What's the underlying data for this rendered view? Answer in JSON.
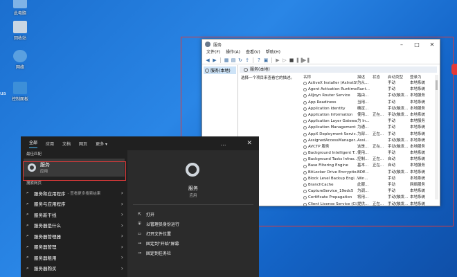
{
  "desktop": {
    "icons": [
      {
        "label": "此电脑",
        "name": "this-pc"
      },
      {
        "label": "回收站",
        "name": "recycle-bin"
      },
      {
        "label": "网络",
        "name": "network"
      },
      {
        "label": "控制面板",
        "name": "control-panel"
      }
    ],
    "left_fragment": "ua"
  },
  "services_window": {
    "title": "服务",
    "menu": [
      "文件(F)",
      "操作(A)",
      "查看(V)",
      "帮助(H)"
    ],
    "tree_item": "服务(本地)",
    "header": "服务(本地)",
    "description": "选择一个项目来查看它的描述。",
    "columns": [
      "名称",
      "描述",
      "状态",
      "启动类型",
      "登录为"
    ],
    "rows": [
      [
        "ActiveX Installer (AxInstSV)",
        "为从...",
        "",
        "手动",
        "本地系统"
      ],
      [
        "Agent Activation Runtime...",
        "Runt...",
        "",
        "手动",
        "本地系统"
      ],
      [
        "AllJoyn Router Service",
        "路由...",
        "",
        "手动(触发...",
        "本地服务"
      ],
      [
        "App Readiness",
        "当用...",
        "",
        "手动",
        "本地系统"
      ],
      [
        "Application Identity",
        "确定...",
        "",
        "手动(触发...",
        "本地服务"
      ],
      [
        "Application Information",
        "使用...",
        "正在...",
        "手动(触发...",
        "本地系统"
      ],
      [
        "Application Layer Gatewa...",
        "为 In...",
        "",
        "手动",
        "本地服务"
      ],
      [
        "Application Management",
        "为通...",
        "",
        "手动",
        "本地系统"
      ],
      [
        "AppX Deployment Servic...",
        "为部...",
        "正在...",
        "手动",
        "本地系统"
      ],
      [
        "AssignedAccessManager...",
        "Assi...",
        "",
        "手动(触发...",
        "本地系统"
      ],
      [
        "AVCTP 服务",
        "这是...",
        "正在...",
        "手动(触发...",
        "本地服务"
      ],
      [
        "Background Intelligent T...",
        "使用...",
        "",
        "手动",
        "本地系统"
      ],
      [
        "Background Tasks Infras...",
        "控制...",
        "正在...",
        "自动",
        "本地系统"
      ],
      [
        "Base Filtering Engine",
        "基本...",
        "正在...",
        "自动",
        "本地服务"
      ],
      [
        "BitLocker Drive Encryptio...",
        "BDE...",
        "",
        "手动(触发...",
        "本地系统"
      ],
      [
        "Block Level Backup Engi...",
        "Win...",
        "",
        "手动",
        "本地系统"
      ],
      [
        "BranchCache",
        "此服...",
        "",
        "手动",
        "网络服务"
      ],
      [
        "CaptureService_19edc5",
        "为调...",
        "",
        "手动",
        "本地系统"
      ],
      [
        "Certificate Propagation",
        "将用...",
        "",
        "手动(触发...",
        "本地系统"
      ],
      [
        "Client License Service (Cl...",
        "提供...",
        "正在...",
        "手动(触发...",
        "本地系统"
      ]
    ]
  },
  "search_panel": {
    "tabs": [
      "全部",
      "应用",
      "文档",
      "网页",
      "更多 ▾"
    ],
    "more_icon": "…",
    "close_icon": "✕",
    "best_match_label": "最佳匹配",
    "best_match": {
      "title": "服务",
      "subtitle": "应用"
    },
    "web_search_label": "搜索网页",
    "suggestions": [
      {
        "text": "服务和应用程序",
        "hint": "- 查看更多搜索结果"
      },
      {
        "text": "服务与应用程序",
        "hint": ""
      },
      {
        "text": "服务新干线",
        "hint": ""
      },
      {
        "text": "服务器是什么",
        "hint": ""
      },
      {
        "text": "服务器管理器",
        "hint": ""
      },
      {
        "text": "服务器管理",
        "hint": ""
      },
      {
        "text": "服务器租用",
        "hint": ""
      },
      {
        "text": "服务器购买",
        "hint": ""
      }
    ],
    "detail": {
      "title": "服务",
      "subtitle": "应用",
      "actions": [
        "打开",
        "以管理员身份运行",
        "打开文件位置",
        "固定到\"开始\"屏幕",
        "固定到任务栏"
      ]
    }
  },
  "colors": {
    "highlight": "#e03a3a",
    "accent": "#4cc2ff"
  }
}
